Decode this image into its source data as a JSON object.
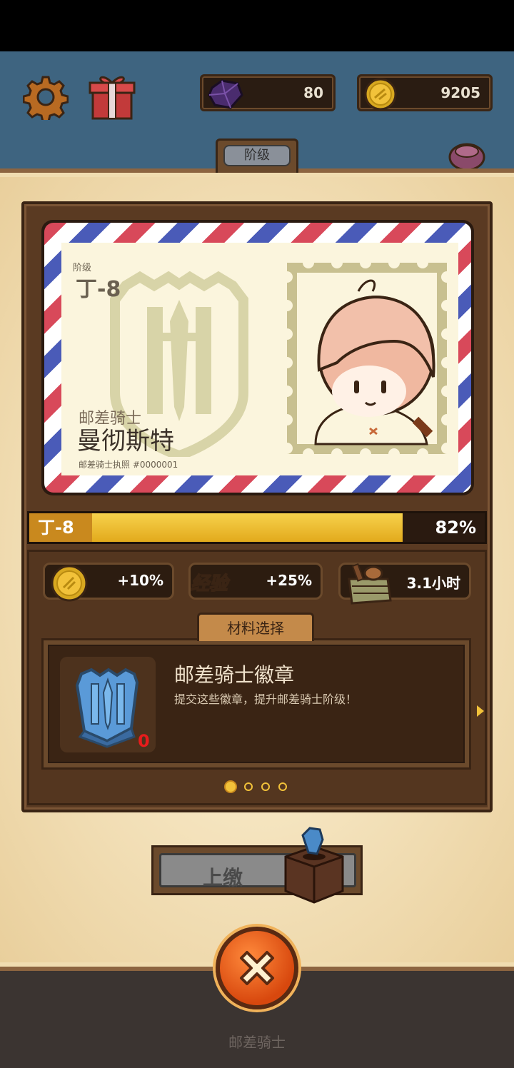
{
  "currency": {
    "gems": "80",
    "coins": "9205",
    "gem_icon": "purple-gem-icon",
    "coin_icon": "gold-coin-icon"
  },
  "header": {
    "tab_label": "阶级"
  },
  "license_card": {
    "rank_label": "阶级",
    "rank_value": "丁-8",
    "role": "邮差骑士",
    "name": "曼彻斯特",
    "license_number": "邮差骑士执照 #0000001"
  },
  "progress": {
    "level": "丁-8",
    "percent_text": "82%",
    "fraction": 0.82
  },
  "bonuses": {
    "coin_bonus": "+10%",
    "exp_label": "经验",
    "exp_bonus": "+25%",
    "time_bonus": "3.1小时"
  },
  "materials": {
    "tab_label": "材料选择",
    "item_title": "邮差骑士徽章",
    "item_desc": "提交这些徽章，提升邮差骑士阶级！",
    "item_count": "0",
    "page_count": 4,
    "active_page": 0
  },
  "actions": {
    "submit_label": "上缴"
  },
  "footer": {
    "label": "邮差骑士"
  },
  "colors": {
    "accent": "#f2c23a",
    "panel": "#5a3a22",
    "parchment": "#f0dcb0",
    "close_button": "#e8581a"
  }
}
